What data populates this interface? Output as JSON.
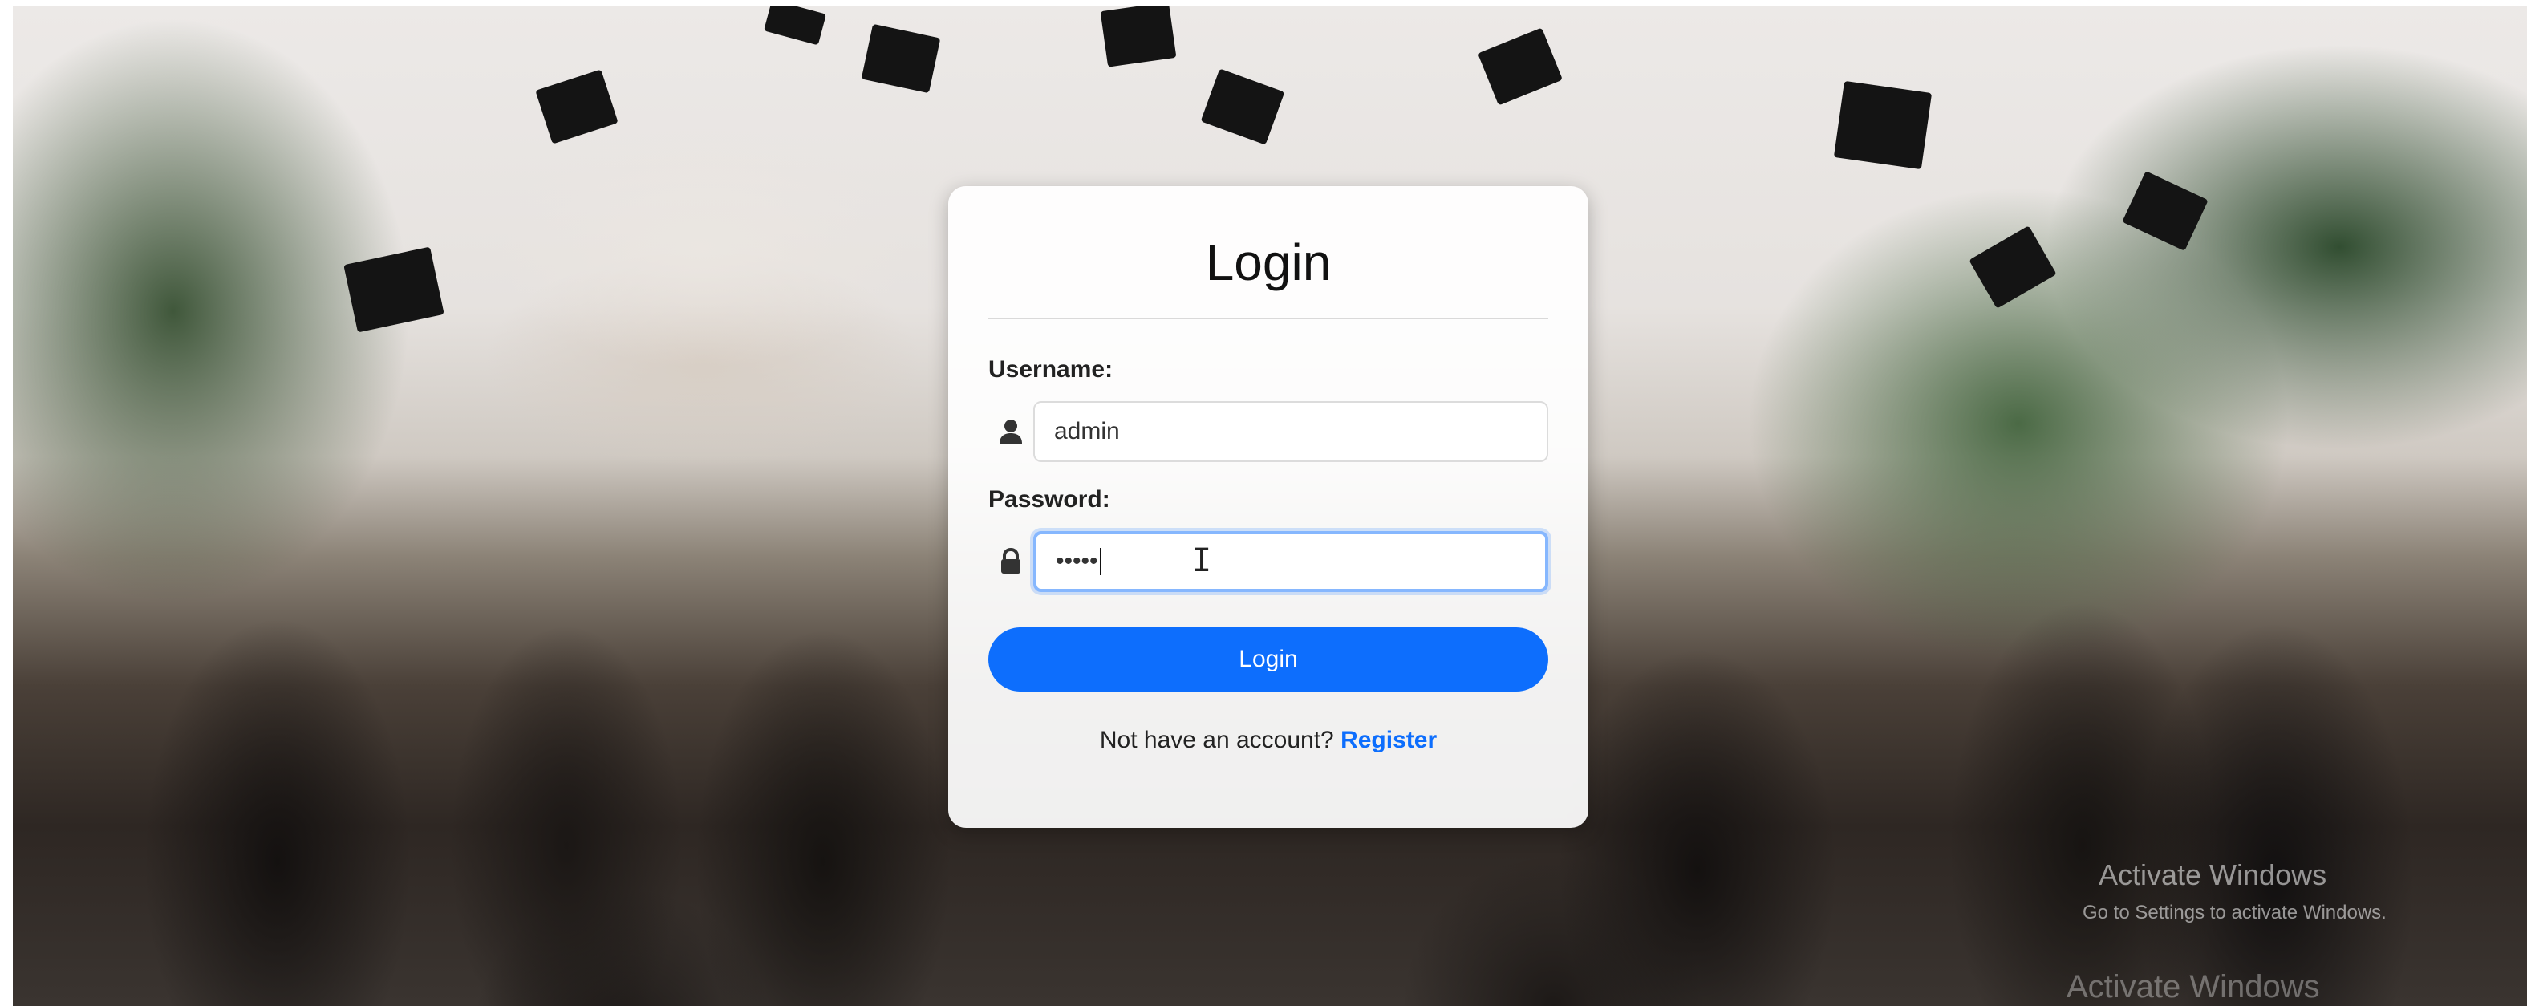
{
  "login": {
    "title": "Login",
    "username_label": "Username:",
    "username_value": "admin",
    "password_label": "Password:",
    "password_value": "•••••",
    "submit_label": "Login",
    "register_prompt": "Not have an account?",
    "register_link": "Register"
  },
  "icons": {
    "username": "user-icon",
    "password": "lock-icon"
  },
  "colors": {
    "accent": "#0d6efd",
    "card_background": "#ffffff",
    "focus_ring": "#86b7fe"
  },
  "watermark": {
    "line1": "Activate Windows",
    "line2": "Go to Settings to activate Windows.",
    "line3": "Activate Windows"
  }
}
